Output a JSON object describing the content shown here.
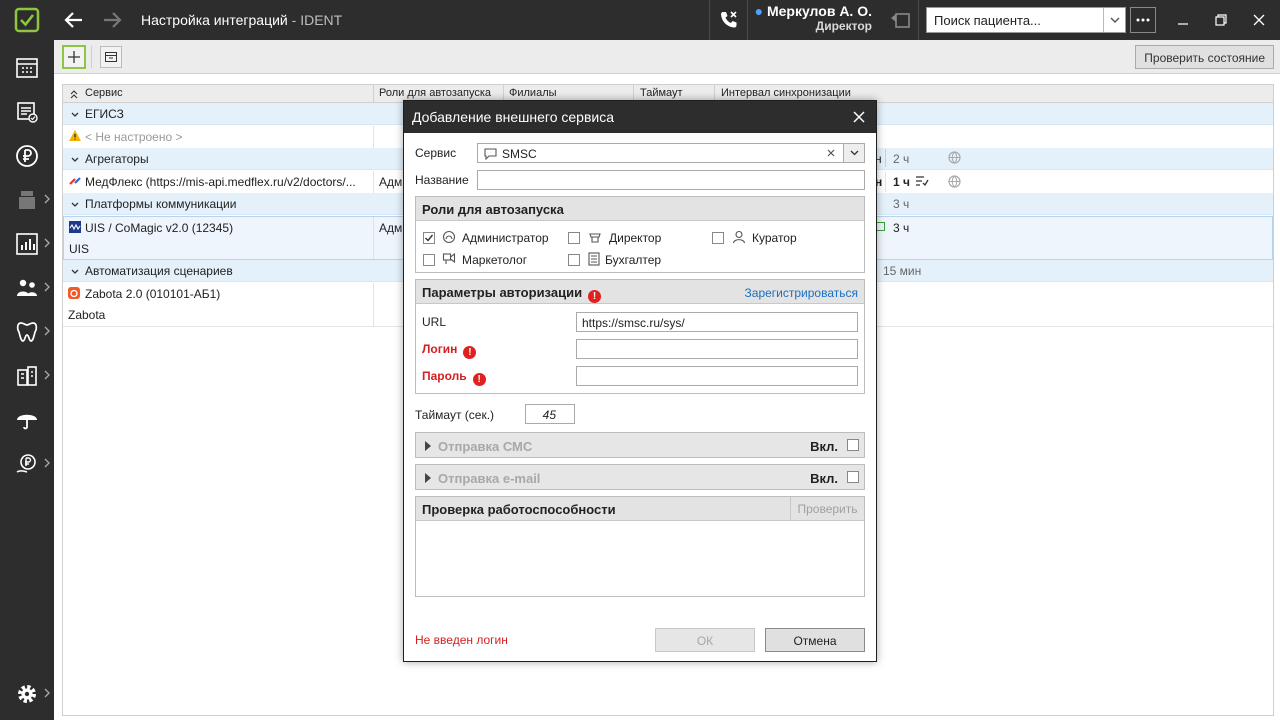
{
  "window": {
    "title": "Настройка интеграций",
    "app": "IDENT",
    "user_name": "Меркулов А. О.",
    "user_role": "Директор",
    "search_placeholder": "Поиск пациента..."
  },
  "toolbar": {
    "check_status_label": "Проверить состояние"
  },
  "grid": {
    "columns": [
      "Сервис",
      "Роли для автозапуска",
      "Филиалы",
      "Таймаут",
      "Интервал синхронизации"
    ],
    "groups": [
      {
        "label": "ЕГИСЗ"
      },
      {
        "label": "Агрегаторы"
      },
      {
        "label": "Платформы коммуникации"
      },
      {
        "label": "Автоматизация сценариев"
      }
    ],
    "rows": [
      {
        "service": "< Не настроено >",
        "group": 0
      },
      {
        "service": "МедФлекс (https://mis-api.medflex.ru/v2/doctors/...",
        "roles": "Адм",
        "interval": "1 ч",
        "group_interval": "2 ч"
      },
      {
        "service": "UIS / CoMagic v2.0 (12345)",
        "sub": "UIS",
        "roles": "Адм",
        "group_interval": "3 ч",
        "interval": "3 ч"
      },
      {
        "service": "Zabota 2.0 (010101-АБ1)",
        "sub": "Zabota",
        "group_interval": "15 мин"
      }
    ],
    "partial_prefix": "н"
  },
  "dialog": {
    "title": "Добавление внешнего сервиса",
    "service_label": "Сервис",
    "service_value": "SMSC",
    "name_label": "Название",
    "name_value": "",
    "roles_title": "Роли для автозапуска",
    "roles": [
      {
        "label": "Администратор",
        "checked": true
      },
      {
        "label": "Директор",
        "checked": false
      },
      {
        "label": "Куратор",
        "checked": false
      },
      {
        "label": "Маркетолог",
        "checked": false
      },
      {
        "label": "Бухгалтер",
        "checked": false
      }
    ],
    "auth_title": "Параметры авторизации",
    "register_link": "Зарегистрироваться",
    "url_label": "URL",
    "url_value": "https://smsc.ru/sys/",
    "login_label": "Логин",
    "password_label": "Пароль",
    "timeout_label": "Таймаут (сек.)",
    "timeout_value": "45",
    "sms_title": "Отправка СМС",
    "email_title": "Отправка e-mail",
    "enabled_label": "Вкл.",
    "health_title": "Проверка работоспособности",
    "health_check_button": "Проверить",
    "error_text": "Не введен логин",
    "ok_label": "ОК",
    "cancel_label": "Отмена"
  },
  "colors": {
    "accent_green": "#8ec63f",
    "group_bg": "#e4f1fb",
    "error_red": "#e12020",
    "link_blue": "#1a6fc4",
    "dark_chrome": "#2d2d2d"
  }
}
